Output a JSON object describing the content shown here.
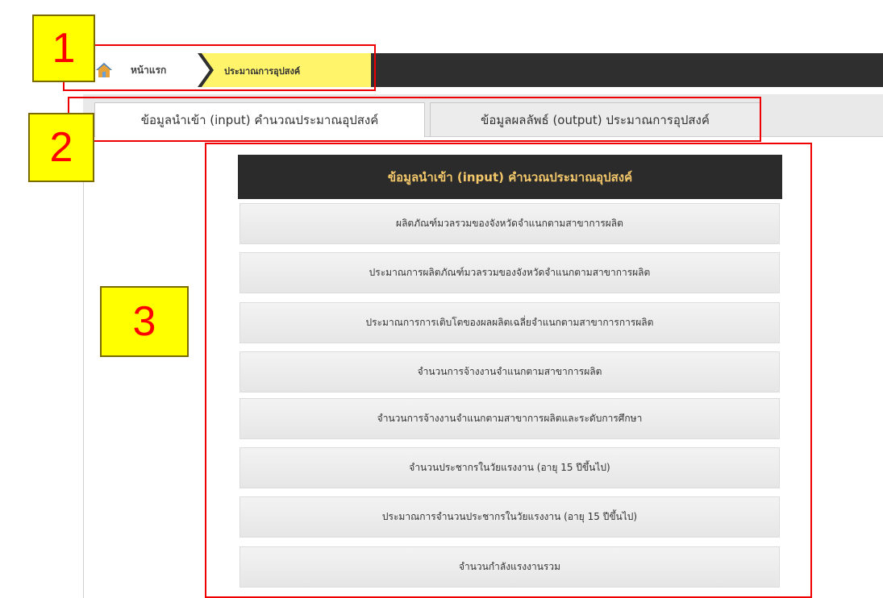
{
  "breadcrumb": {
    "home_label": "หน้าแรก",
    "current_label": "ประมาณการอุปสงค์"
  },
  "tabs": [
    {
      "label": "ข้อมูลนำเข้า (input) คำนวณประมาณอุปสงค์",
      "active": true
    },
    {
      "label": "ข้อมูลผลลัพธ์ (output) ประมาณการอุปสงค์",
      "active": false
    }
  ],
  "panel": {
    "header": "ข้อมูลนำเข้า (input) คำนวณประมาณอุปสงค์",
    "items": [
      "ผลิตภัณฑ์มวลรวมของจังหวัดจำแนกตามสาขาการผลิต",
      "ประมาณการผลิตภัณฑ์มวลรวมของจังหวัดจำแนกตามสาขาการผลิต",
      "ประมาณการการเติบโตของผลผลิตเฉลี่ยจำแนกตามสาขาการการผลิต",
      "จำนวนการจ้างงานจำแนกตามสาขาการผลิต",
      "จำนวนการจ้างงานจำแนกตามสาขาการผลิตและระดับการศึกษา",
      "จำนวนประชากรในวัยแรงงาน (อายุ 15 ปีขึ้นไป)",
      "ประมาณการจำนวนประชากรในวัยแรงงาน (อายุ 15 ปีขึ้นไป)",
      "จำนวนกำลังแรงงานรวม"
    ]
  },
  "callouts": [
    "1",
    "2",
    "3"
  ],
  "colors": {
    "topbar": "#2f2f2f",
    "breadcrumb_current": "#fff46a",
    "panel_header_bg": "#2b2b2b",
    "panel_header_text": "#f3c76a",
    "annotation_red": "#ee0000",
    "callout_yellow": "#ffff00"
  },
  "icons": {
    "home": "home-icon"
  }
}
